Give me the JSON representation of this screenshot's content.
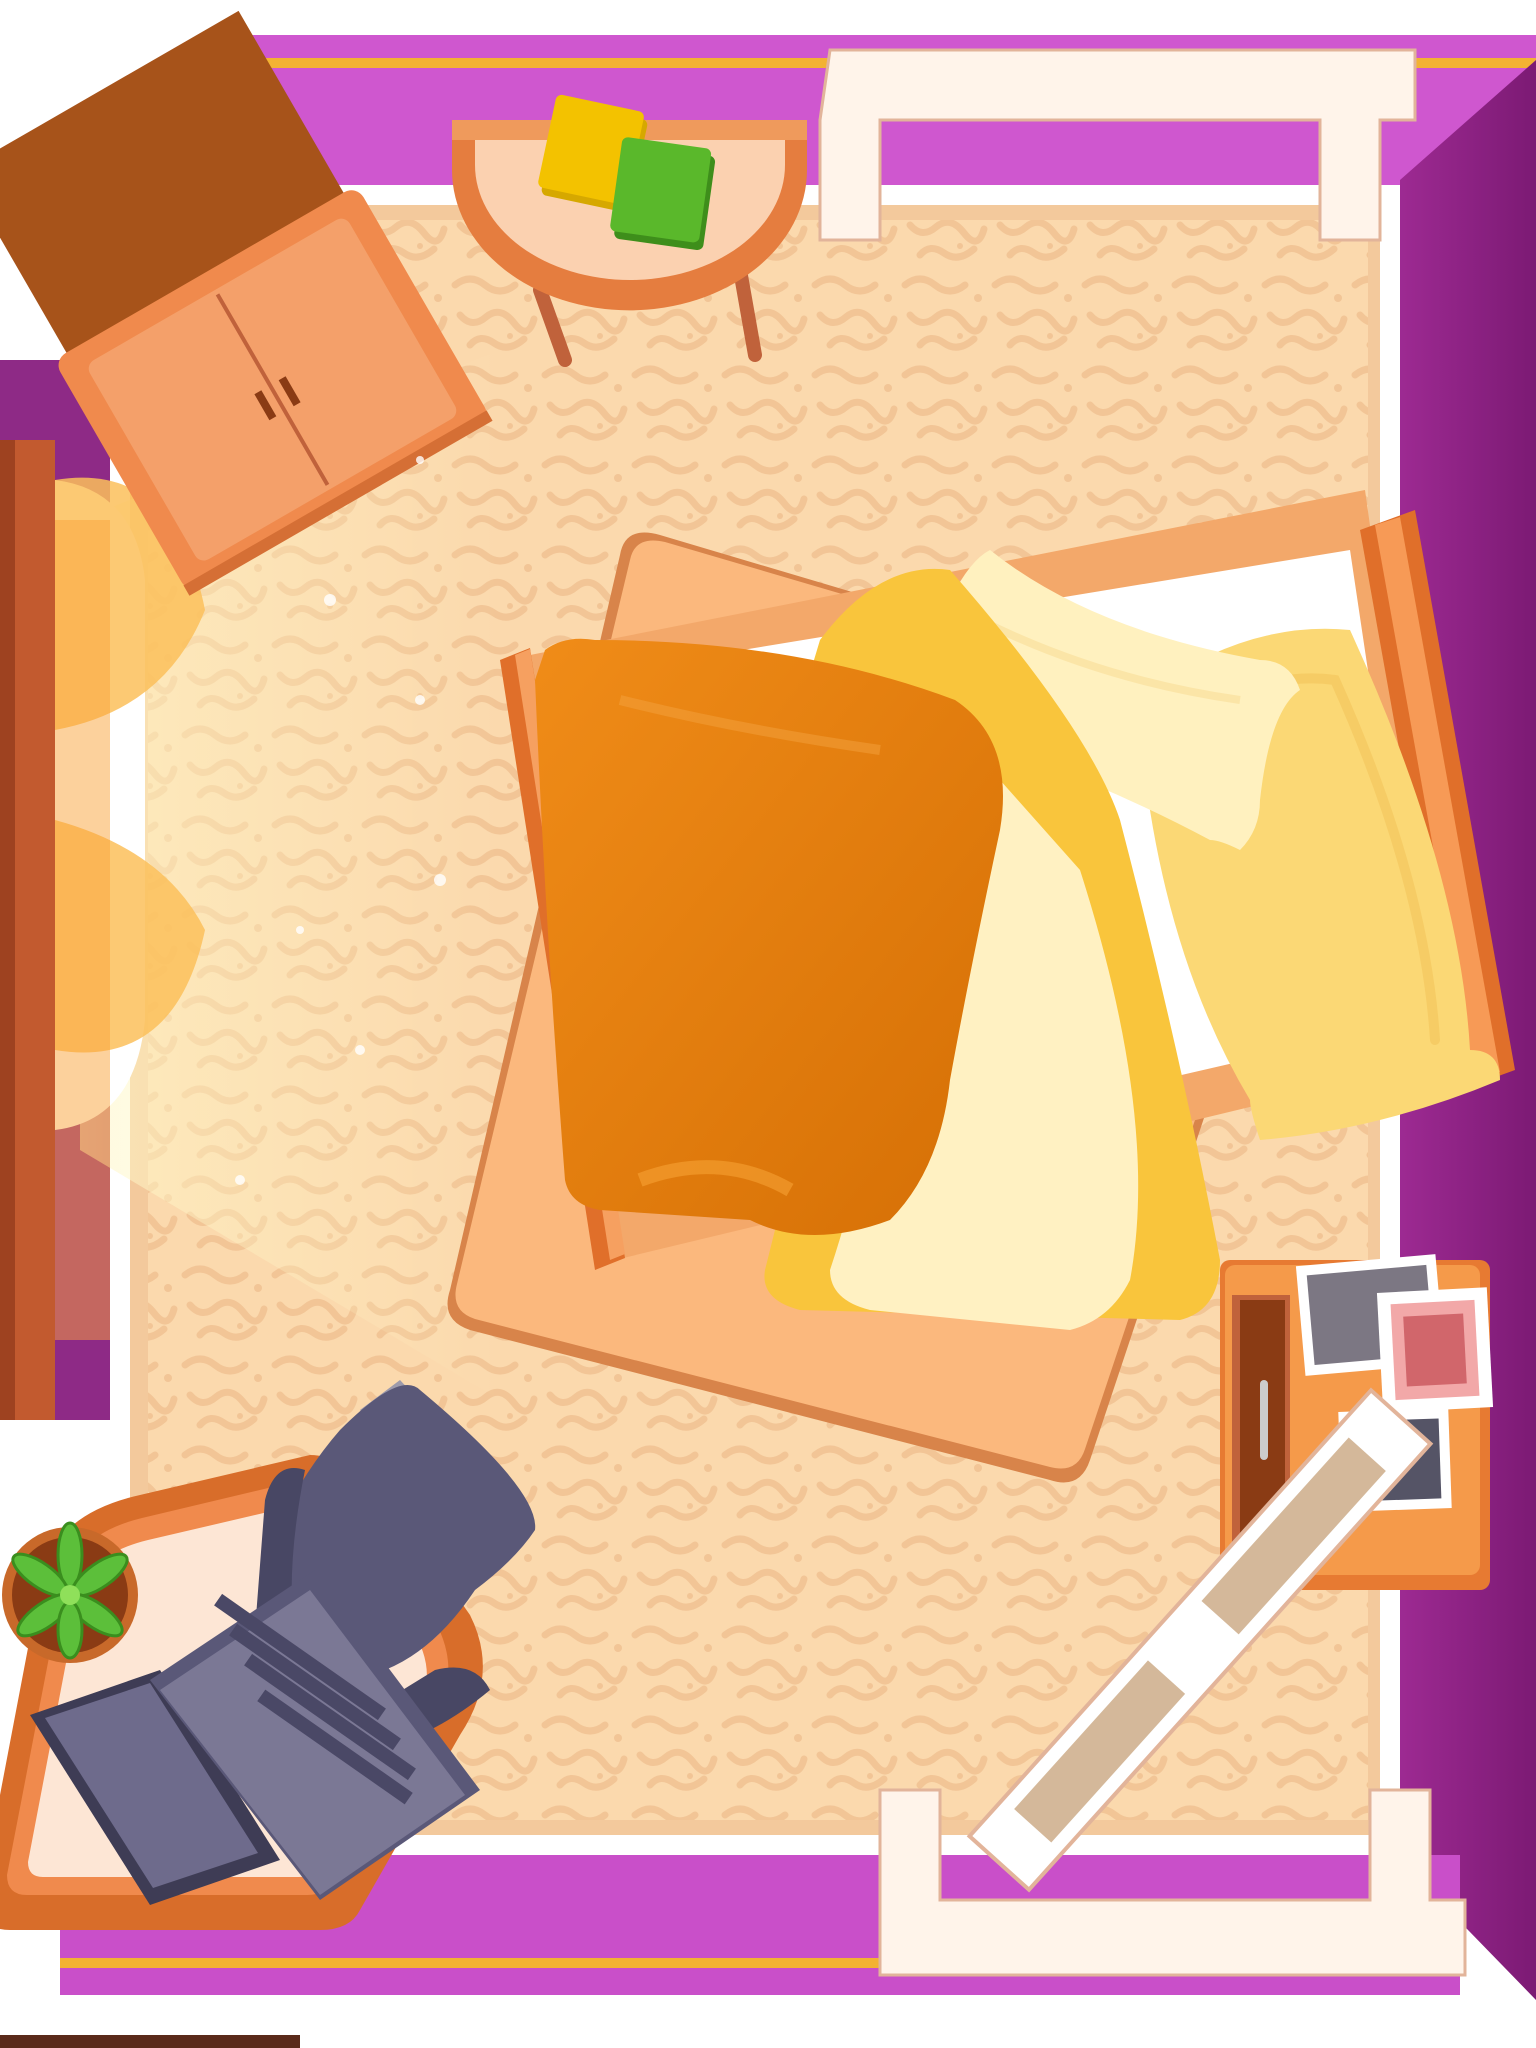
{
  "scene": {
    "type": "top-down bedroom room (casual decorating game)",
    "objects": [
      "wardrobe-cabinet",
      "half-round-side-table",
      "book-yellow",
      "book-green",
      "doorway-top",
      "doorway-bottom",
      "window-left",
      "bed",
      "pillow-cream",
      "pillow-yellow",
      "orange-blanket",
      "cream-blanket",
      "floor-rug",
      "nightstand-with-photos",
      "open-door",
      "desk",
      "office-chair",
      "laptop",
      "potted-plant"
    ]
  },
  "colors": {
    "wall_purple": "#b63fb6",
    "wall_purple_dark": "#8a1f7f",
    "floor": "#fbd9ad",
    "floor_pattern": "#f1c394",
    "accent_gold": "#f3b233",
    "wood_orange": "#e8874a",
    "wood_dark": "#a24a15",
    "blanket_orange": "#e27a0c",
    "pillow_cream": "#fff1bf",
    "pillow_yellow": "#fbd875",
    "laptop_grey": "#5a5878",
    "chair_grey": "#484764",
    "plant_green": "#5cbf3a",
    "book_yellow": "#f3c200",
    "book_green": "#5ab82b"
  }
}
